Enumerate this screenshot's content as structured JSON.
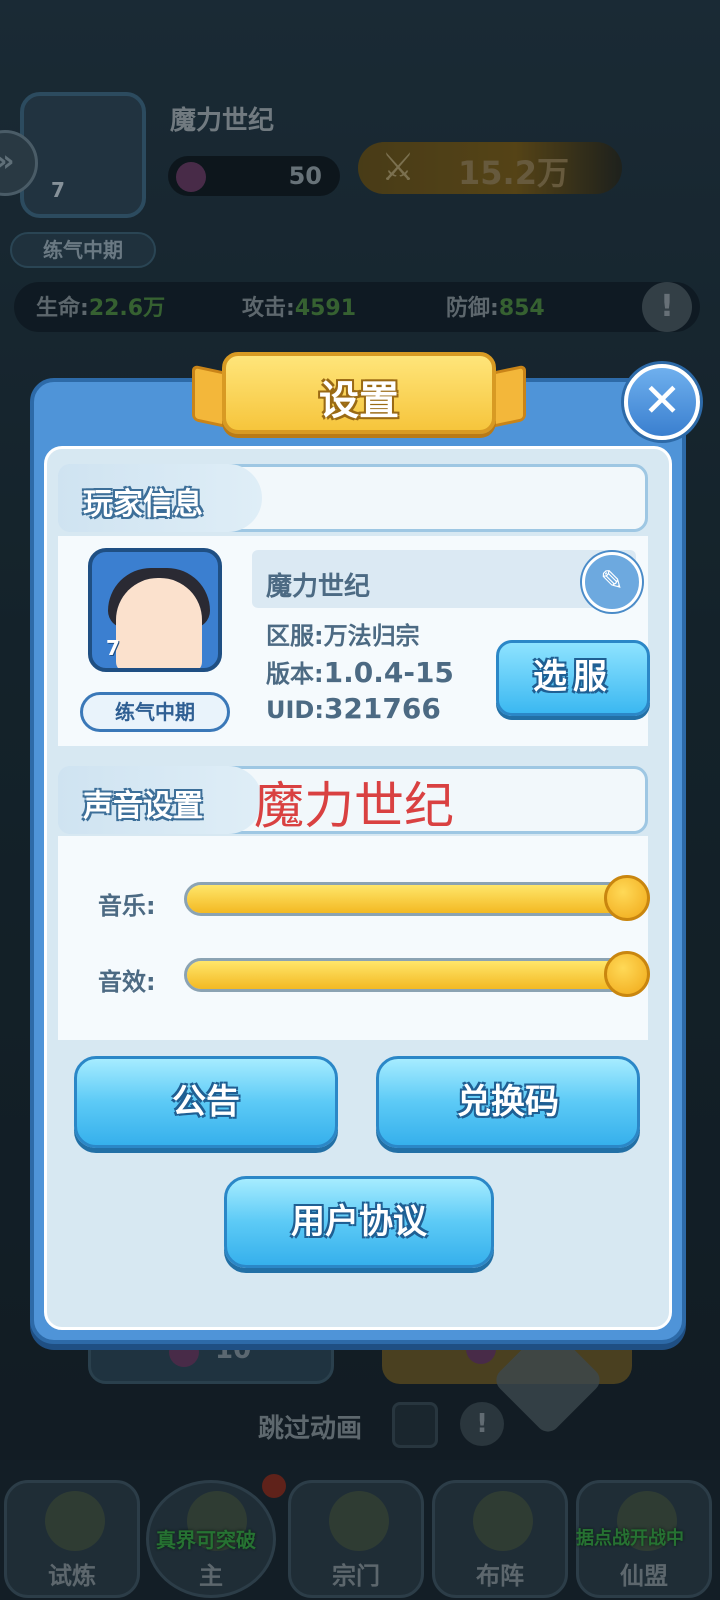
{
  "hud": {
    "player_name": "魔力世纪",
    "level": "7",
    "rank": "练气中期",
    "energy": "50",
    "power": "15.2万",
    "stats": {
      "hp_label": "生命:",
      "hp_value": "22.6万",
      "atk_label": "攻击:",
      "atk_value": "4591",
      "def_label": "防御:",
      "def_value": "854"
    }
  },
  "background": {
    "left_cost": "10",
    "skip_animation_label": "跳过动画"
  },
  "nav": {
    "items": [
      {
        "label": "试炼"
      },
      {
        "label": "主"
      },
      {
        "label": "宗门"
      },
      {
        "label": "布阵"
      },
      {
        "label": "仙盟"
      }
    ],
    "tags": {
      "item2": "真界可突破",
      "item5": "据点战开战中"
    }
  },
  "settings": {
    "title": "设置",
    "close_icon": "close-icon",
    "player_info": {
      "header": "玩家信息",
      "name": "魔力世纪",
      "level": "7",
      "rank": "练气中期",
      "server_label": "区服:",
      "server_value": "万法归宗",
      "version_label": "版本:",
      "version_value": "1.0.4-15",
      "uid_label": "UID:",
      "uid_value": "321766",
      "select_server_button": "选服"
    },
    "sound": {
      "header": "声音设置",
      "overlay_text": "魔力世纪",
      "music_label": "音乐:",
      "music_level": 1.0,
      "sfx_label": "音效:",
      "sfx_level": 1.0
    },
    "buttons": {
      "announcement": "公告",
      "redeem_code": "兑换码",
      "user_agreement": "用户协议"
    },
    "colors": {
      "panel_blue": "#4f94d8",
      "title_gold": "#f6c53c",
      "button_cyan": "#5ccaf6",
      "slider_gold": "#f3b923"
    }
  }
}
